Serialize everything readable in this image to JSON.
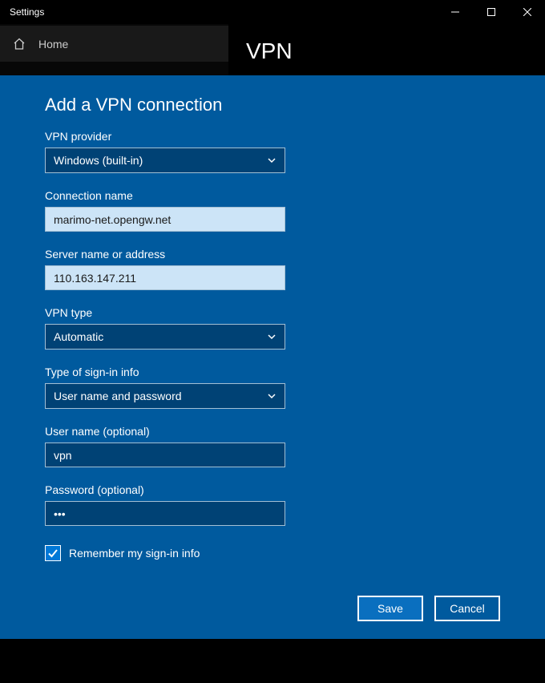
{
  "window": {
    "title": "Settings"
  },
  "sidebar": {
    "home_label": "Home"
  },
  "main": {
    "title": "VPN"
  },
  "modal": {
    "title": "Add a VPN connection",
    "fields": {
      "provider": {
        "label": "VPN provider",
        "value": "Windows (built-in)"
      },
      "connection_name": {
        "label": "Connection name",
        "value": "marimo-net.opengw.net"
      },
      "server": {
        "label": "Server name or address",
        "value": "110.163.147.211"
      },
      "vpn_type": {
        "label": "VPN type",
        "value": "Automatic"
      },
      "signin_type": {
        "label": "Type of sign-in info",
        "value": "User name and password"
      },
      "username": {
        "label": "User name (optional)",
        "value": "vpn"
      },
      "password": {
        "label": "Password (optional)",
        "value": "•••"
      }
    },
    "remember": {
      "label": "Remember my sign-in info",
      "checked": true
    },
    "buttons": {
      "save": "Save",
      "cancel": "Cancel"
    }
  }
}
